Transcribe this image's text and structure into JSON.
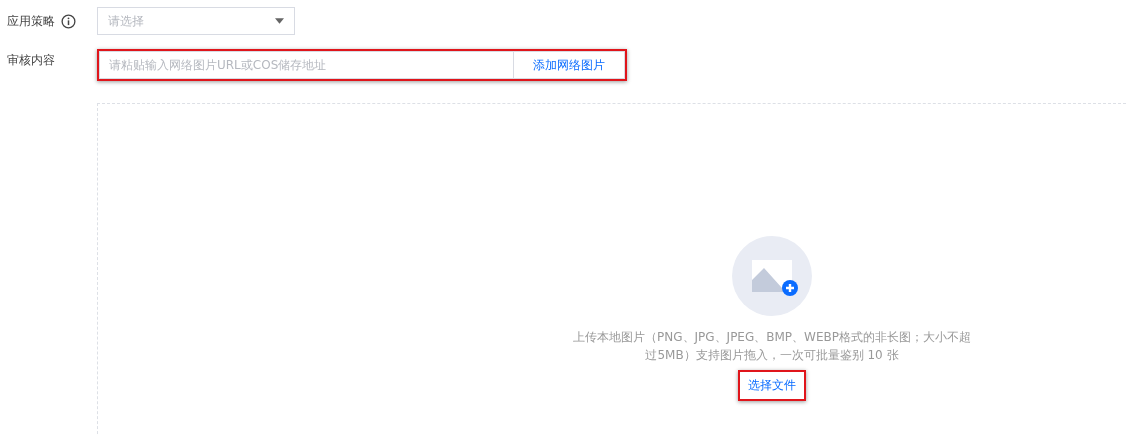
{
  "policy": {
    "label": "应用策略",
    "select": {
      "placeholder": "请选择"
    }
  },
  "content": {
    "label": "审核内容",
    "url_field": {
      "placeholder": "请粘贴输入网络图片URL或COS储存地址",
      "highlighted": true
    },
    "add_button": {
      "label": "添加网络图片"
    }
  },
  "upload": {
    "hint": "上传本地图片（PNG、JPG、JPEG、BMP、WEBP格式的非长图；大小不超过5MB）支持图片拖入，一次可批量鉴别 10 张",
    "button": {
      "label": "选择文件",
      "highlighted": true
    }
  }
}
